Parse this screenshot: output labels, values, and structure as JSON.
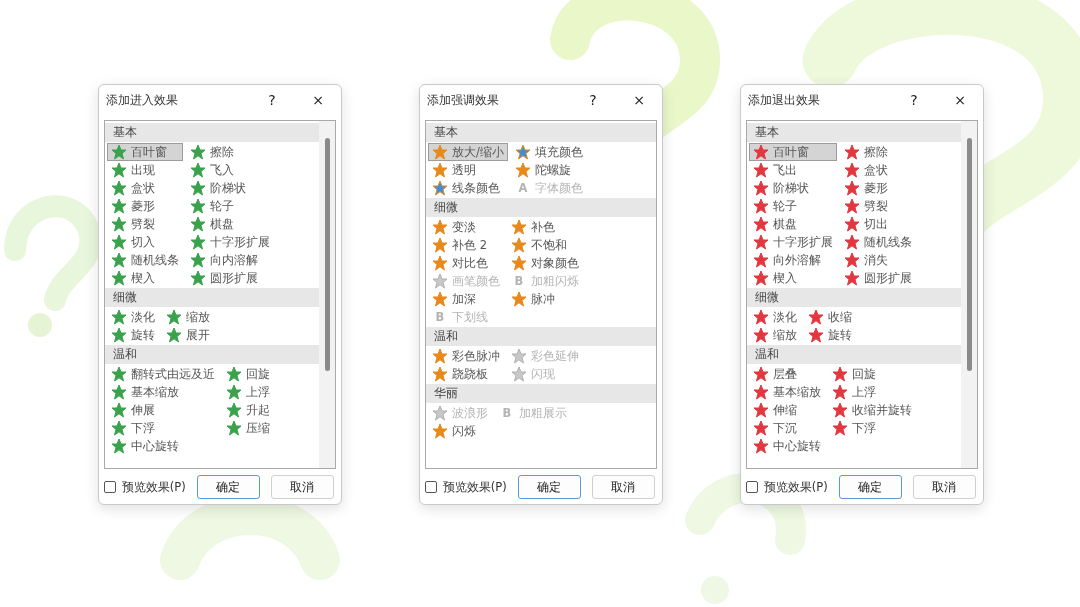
{
  "dialogs": [
    {
      "title": "添加进入效果",
      "help_button": "?",
      "close_button": "×",
      "color": "#3aa24c",
      "scrollbar": true,
      "groups": [
        {
          "heading": "基本",
          "items": [
            {
              "label": "百叶窗",
              "kind": "star",
              "selected": true
            },
            {
              "label": "擦除",
              "kind": "star",
              "selected": false
            },
            {
              "label": "出现",
              "kind": "star",
              "selected": false
            },
            {
              "label": "飞入",
              "kind": "star",
              "selected": false
            },
            {
              "label": "盒状",
              "kind": "star",
              "selected": false
            },
            {
              "label": "阶梯状",
              "kind": "star",
              "selected": false
            },
            {
              "label": "菱形",
              "kind": "star",
              "selected": false
            },
            {
              "label": "轮子",
              "kind": "star",
              "selected": false
            },
            {
              "label": "劈裂",
              "kind": "star",
              "selected": false
            },
            {
              "label": "棋盘",
              "kind": "star",
              "selected": false
            },
            {
              "label": "切入",
              "kind": "star",
              "selected": false
            },
            {
              "label": "十字形扩展",
              "kind": "star",
              "selected": false
            },
            {
              "label": "随机线条",
              "kind": "star",
              "selected": false
            },
            {
              "label": "向内溶解",
              "kind": "star",
              "selected": false
            },
            {
              "label": "楔入",
              "kind": "star",
              "selected": false
            },
            {
              "label": "圆形扩展",
              "kind": "star",
              "selected": false
            }
          ]
        },
        {
          "heading": "细微",
          "items": [
            {
              "label": "淡化",
              "kind": "star",
              "selected": false
            },
            {
              "label": "缩放",
              "kind": "star",
              "selected": false
            },
            {
              "label": "旋转",
              "kind": "star",
              "selected": false
            },
            {
              "label": "展开",
              "kind": "star",
              "selected": false
            }
          ]
        },
        {
          "heading": "温和",
          "items": [
            {
              "label": "翻转式由远及近",
              "kind": "star",
              "selected": false
            },
            {
              "label": "回旋",
              "kind": "star",
              "selected": false
            },
            {
              "label": "基本缩放",
              "kind": "star",
              "selected": false
            },
            {
              "label": "上浮",
              "kind": "star",
              "selected": false
            },
            {
              "label": "伸展",
              "kind": "star",
              "selected": false
            },
            {
              "label": "升起",
              "kind": "star",
              "selected": false
            },
            {
              "label": "下浮",
              "kind": "star",
              "selected": false
            },
            {
              "label": "压缩",
              "kind": "star",
              "selected": false
            },
            {
              "label": "中心旋转",
              "kind": "star",
              "selected": false
            }
          ]
        }
      ],
      "preview": {
        "label": "预览效果(P)",
        "checked": false
      },
      "buttons": [
        {
          "label": "确定",
          "default": true
        },
        {
          "label": "取消",
          "default": false
        }
      ]
    },
    {
      "title": "添加强调效果",
      "help_button": "?",
      "close_button": "×",
      "color": "#e8891c",
      "scrollbar": false,
      "groups": [
        {
          "heading": "基本",
          "items": [
            {
              "label": "放大/缩小",
              "kind": "star",
              "selected": true,
              "disabled": false
            },
            {
              "label": "填充颜色",
              "kind": "fill",
              "selected": false,
              "disabled": false
            },
            {
              "label": "透明",
              "kind": "star",
              "selected": false,
              "disabled": false
            },
            {
              "label": "陀螺旋",
              "kind": "star",
              "selected": false,
              "disabled": false
            },
            {
              "label": "线条颜色",
              "kind": "fill",
              "selected": false,
              "disabled": false
            },
            {
              "label": "字体颜色",
              "kind": "glyph",
              "glyph": "A",
              "selected": false,
              "disabled": true
            }
          ]
        },
        {
          "heading": "细微",
          "items": [
            {
              "label": "变淡",
              "kind": "star",
              "selected": false,
              "disabled": false
            },
            {
              "label": "补色",
              "kind": "star",
              "selected": false,
              "disabled": false
            },
            {
              "label": "补色 2",
              "kind": "star",
              "selected": false,
              "disabled": false
            },
            {
              "label": "不饱和",
              "kind": "star",
              "selected": false,
              "disabled": false
            },
            {
              "label": "对比色",
              "kind": "star",
              "selected": false,
              "disabled": false
            },
            {
              "label": "对象颜色",
              "kind": "star",
              "selected": false,
              "disabled": false
            },
            {
              "label": "画笔颜色",
              "kind": "star",
              "selected": false,
              "disabled": true
            },
            {
              "label": "加粗闪烁",
              "kind": "glyph",
              "glyph": "B",
              "selected": false,
              "disabled": true
            },
            {
              "label": "加深",
              "kind": "star",
              "selected": false,
              "disabled": false
            },
            {
              "label": "脉冲",
              "kind": "star",
              "selected": false,
              "disabled": false
            },
            {
              "label": "下划线",
              "kind": "glyph",
              "glyph": "B",
              "selected": false,
              "disabled": true
            }
          ]
        },
        {
          "heading": "温和",
          "items": [
            {
              "label": "彩色脉冲",
              "kind": "star",
              "selected": false,
              "disabled": false
            },
            {
              "label": "彩色延伸",
              "kind": "star",
              "selected": false,
              "disabled": true
            },
            {
              "label": "跷跷板",
              "kind": "star",
              "selected": false,
              "disabled": false
            },
            {
              "label": "闪现",
              "kind": "star",
              "selected": false,
              "disabled": true
            }
          ]
        },
        {
          "heading": "华丽",
          "items": [
            {
              "label": "波浪形",
              "kind": "star",
              "selected": false,
              "disabled": true
            },
            {
              "label": "加粗展示",
              "kind": "glyph",
              "glyph": "B",
              "selected": false,
              "disabled": true
            },
            {
              "label": "闪烁",
              "kind": "star",
              "selected": false,
              "disabled": false
            }
          ]
        }
      ],
      "preview": {
        "label": "预览效果(P)",
        "checked": false
      },
      "buttons": [
        {
          "label": "确定",
          "default": true
        },
        {
          "label": "取消",
          "default": false
        }
      ]
    },
    {
      "title": "添加退出效果",
      "help_button": "?",
      "close_button": "×",
      "color": "#e2373f",
      "scrollbar": true,
      "groups": [
        {
          "heading": "基本",
          "items": [
            {
              "label": "百叶窗",
              "kind": "star",
              "selected": true
            },
            {
              "label": "擦除",
              "kind": "star",
              "selected": false
            },
            {
              "label": "飞出",
              "kind": "star",
              "selected": false
            },
            {
              "label": "盒状",
              "kind": "star",
              "selected": false
            },
            {
              "label": "阶梯状",
              "kind": "star",
              "selected": false
            },
            {
              "label": "菱形",
              "kind": "star",
              "selected": false
            },
            {
              "label": "轮子",
              "kind": "star",
              "selected": false
            },
            {
              "label": "劈裂",
              "kind": "star",
              "selected": false
            },
            {
              "label": "棋盘",
              "kind": "star",
              "selected": false
            },
            {
              "label": "切出",
              "kind": "star",
              "selected": false
            },
            {
              "label": "十字形扩展",
              "kind": "star",
              "selected": false
            },
            {
              "label": "随机线条",
              "kind": "star",
              "selected": false
            },
            {
              "label": "向外溶解",
              "kind": "star",
              "selected": false
            },
            {
              "label": "消失",
              "kind": "star",
              "selected": false
            },
            {
              "label": "楔入",
              "kind": "star",
              "selected": false
            },
            {
              "label": "圆形扩展",
              "kind": "star",
              "selected": false
            }
          ]
        },
        {
          "heading": "细微",
          "items": [
            {
              "label": "淡化",
              "kind": "star",
              "selected": false
            },
            {
              "label": "收缩",
              "kind": "star",
              "selected": false
            },
            {
              "label": "缩放",
              "kind": "star",
              "selected": false
            },
            {
              "label": "旋转",
              "kind": "star",
              "selected": false
            }
          ]
        },
        {
          "heading": "温和",
          "items": [
            {
              "label": "层叠",
              "kind": "star",
              "selected": false
            },
            {
              "label": "回旋",
              "kind": "star",
              "selected": false
            },
            {
              "label": "基本缩放",
              "kind": "star",
              "selected": false
            },
            {
              "label": "上浮",
              "kind": "star",
              "selected": false
            },
            {
              "label": "伸缩",
              "kind": "star",
              "selected": false
            },
            {
              "label": "收缩并旋转",
              "kind": "star",
              "selected": false
            },
            {
              "label": "下沉",
              "kind": "star",
              "selected": false
            },
            {
              "label": "下浮",
              "kind": "star",
              "selected": false
            },
            {
              "label": "中心旋转",
              "kind": "star",
              "selected": false
            }
          ]
        }
      ],
      "preview": {
        "label": "预览效果(P)",
        "checked": false
      },
      "buttons": [
        {
          "label": "确定",
          "default": true
        },
        {
          "label": "取消",
          "default": false
        }
      ]
    }
  ]
}
